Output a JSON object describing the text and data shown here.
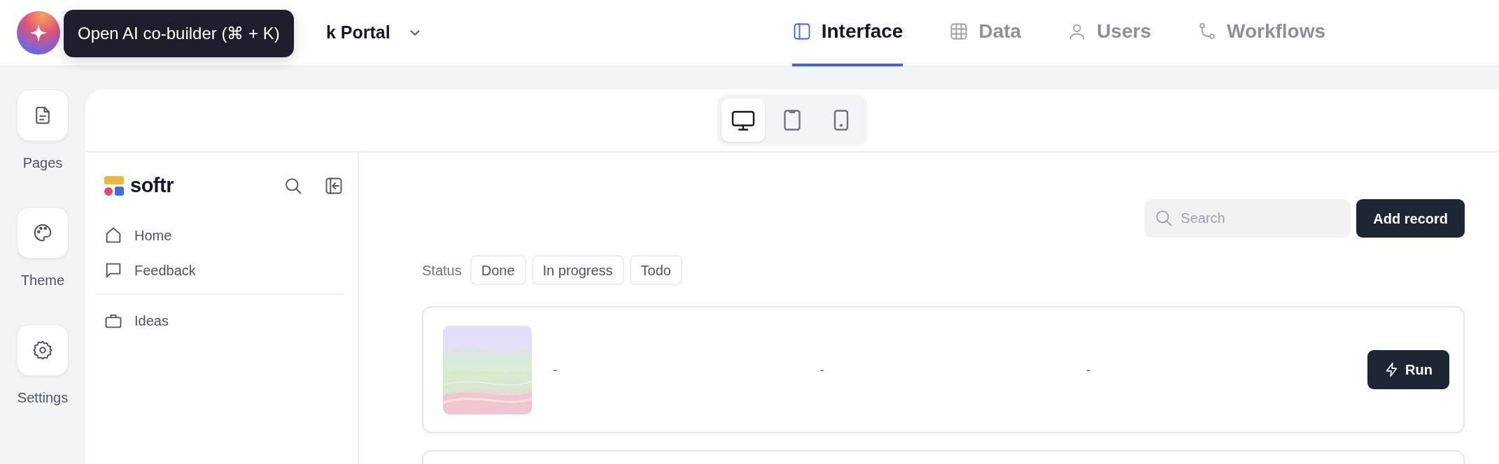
{
  "header": {
    "app_title": "k Portal",
    "tooltip": "Open AI co-builder (⌘ + K)"
  },
  "tabs": [
    {
      "label": "Interface",
      "selected": true
    },
    {
      "label": "Data",
      "selected": false
    },
    {
      "label": "Users",
      "selected": false
    },
    {
      "label": "Workflows",
      "selected": false
    }
  ],
  "rail": [
    {
      "label": "Pages"
    },
    {
      "label": "Theme"
    },
    {
      "label": "Settings"
    }
  ],
  "devices": [
    {
      "selected": true
    },
    {
      "selected": false
    },
    {
      "selected": false
    }
  ],
  "sidebar": {
    "brand": "softr",
    "sections": [
      [
        {
          "label": "Home"
        },
        {
          "label": "Feedback"
        }
      ],
      [
        {
          "label": "Ideas"
        }
      ]
    ]
  },
  "search": {
    "placeholder": "Search"
  },
  "add_button": "Add record",
  "filter": {
    "label": "Status",
    "options": [
      "Done",
      "In progress",
      "Todo"
    ]
  },
  "records": [
    {
      "kind": "full",
      "fields": [
        "-",
        "-",
        "-"
      ],
      "action": "Run"
    },
    {
      "kind": "cut"
    }
  ]
}
